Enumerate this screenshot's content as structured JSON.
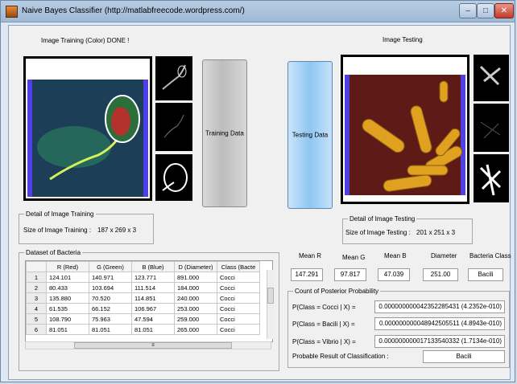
{
  "window": {
    "title": "Naive Bayes Classifier (http://matlabfreecode.wordpress.com/)",
    "minimize": "–",
    "maximize": "□",
    "close": "✕"
  },
  "training": {
    "heading": "Image Training (Color) DONE !",
    "button": "Training Data",
    "detail_legend": "Detail of Image Training",
    "size_label": "Size of Image Training :",
    "size_value": "187 x 269 x 3"
  },
  "testing": {
    "heading": "Image Testing",
    "button": "Testing Data",
    "detail_legend": "Detail of Image Testing",
    "size_label": "Size of Image Testing :",
    "size_value": "201 x 251 x 3"
  },
  "dataset": {
    "legend": "Dataset of Bacteria",
    "columns": [
      "R (Red)",
      "G (Green)",
      "B (Blue)",
      "D (Diameter)",
      "Class (Bacte"
    ],
    "rows": [
      {
        "n": "1",
        "r": "124.101",
        "g": "140.971",
        "b": "123.771",
        "d": "891.000",
        "c": "Cocci"
      },
      {
        "n": "2",
        "r": "80.433",
        "g": "103.694",
        "b": "111.514",
        "d": "184.000",
        "c": "Cocci"
      },
      {
        "n": "3",
        "r": "135.880",
        "g": "70.520",
        "b": "114.851",
        "d": "240.000",
        "c": "Cocci"
      },
      {
        "n": "4",
        "r": "61.535",
        "g": "66.152",
        "b": "106.967",
        "d": "253.000",
        "c": "Cocci"
      },
      {
        "n": "5",
        "r": "108.790",
        "g": "75.963",
        "b": "47.594",
        "d": "259.000",
        "c": "Cocci"
      },
      {
        "n": "6",
        "r": "81.051",
        "g": "81.051",
        "b": "81.051",
        "d": "265.000",
        "c": "Cocci"
      }
    ],
    "scroll_mark": "≡"
  },
  "features": {
    "labels": [
      "Mean R",
      "Mean G",
      "Mean B",
      "Diameter",
      "Bacteria Class"
    ],
    "values": [
      "147.291",
      "97.817",
      "47.039",
      "251.00",
      "Bacili"
    ]
  },
  "posterior": {
    "legend": "Count of Posterior Probability",
    "rows": [
      {
        "label": "P(Class = Cocci | X) =",
        "value": "0.000000000042352285431 (4.2352e-010)"
      },
      {
        "label": "P(Class = Bacili | X) =",
        "value": "0.000000000048942505511 (4.8943e-010)"
      },
      {
        "label": "P(Class = Vibrio | X) =",
        "value": "0.000000000017133540332 (1.7134e-010)"
      }
    ],
    "result_label": "Probable Result of Classification :",
    "result_value": "Bacili"
  },
  "colors": {
    "title_bar": "#a9c1dc",
    "testing_button": "#9ccdf3",
    "training_button": "#c8c8c8"
  }
}
